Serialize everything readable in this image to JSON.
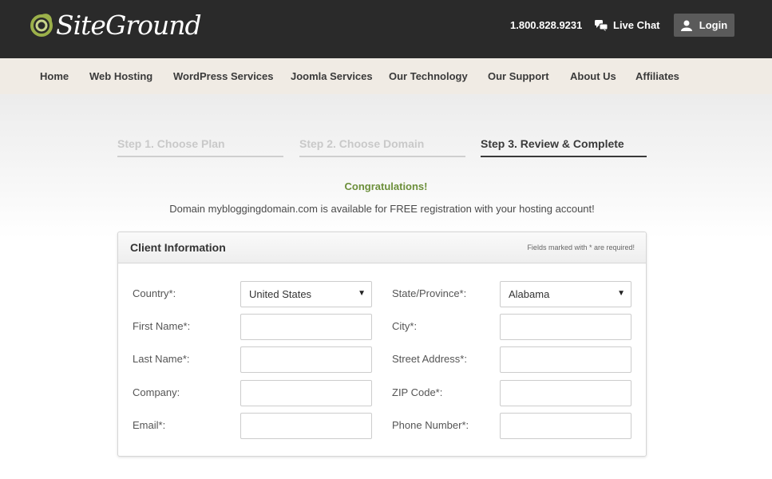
{
  "header": {
    "logo_text": "SiteGround",
    "phone": "1.800.828.9231",
    "live_chat_label": "Live Chat",
    "login_label": "Login"
  },
  "nav": {
    "items": [
      {
        "label": "Home"
      },
      {
        "label": "Web Hosting"
      },
      {
        "label": "WordPress Services"
      },
      {
        "label": "Joomla Services"
      },
      {
        "label": "Our Technology"
      },
      {
        "label": "Our Support"
      },
      {
        "label": "About Us"
      },
      {
        "label": "Affiliates"
      }
    ]
  },
  "steps": [
    {
      "label": "Step 1. Choose Plan",
      "active": false
    },
    {
      "label": "Step 2. Choose Domain",
      "active": false
    },
    {
      "label": "Step 3. Review & Complete",
      "active": true
    }
  ],
  "messages": {
    "congrats": "Congratulations!",
    "domain_available": "Domain mybloggingdomain.com is available for FREE registration with your hosting account!"
  },
  "form": {
    "title": "Client Information",
    "required_note": "Fields marked with * are required!",
    "left_fields": [
      {
        "label": "Country*:",
        "type": "select",
        "value": "United States"
      },
      {
        "label": "First Name*:",
        "type": "text",
        "value": ""
      },
      {
        "label": "Last Name*:",
        "type": "text",
        "value": ""
      },
      {
        "label": "Company:",
        "type": "text",
        "value": ""
      },
      {
        "label": "Email*:",
        "type": "text",
        "value": ""
      }
    ],
    "right_fields": [
      {
        "label": "State/Province*:",
        "type": "select",
        "value": "Alabama"
      },
      {
        "label": "City*:",
        "type": "text",
        "value": ""
      },
      {
        "label": "Street Address*:",
        "type": "text",
        "value": ""
      },
      {
        "label": "ZIP Code*:",
        "type": "text",
        "value": ""
      },
      {
        "label": "Phone Number*:",
        "type": "text",
        "value": ""
      }
    ]
  },
  "colors": {
    "header_bg": "#2a2a2a",
    "nav_bg": "#f0ebe4",
    "congrats_green": "#6c8f3a",
    "logo_green": "#9bb04a"
  },
  "icons": {
    "logo": "siteground-swirl-icon",
    "chat": "chat-bubbles-icon",
    "login": "user-icon",
    "select": "chevron-down-icon"
  }
}
